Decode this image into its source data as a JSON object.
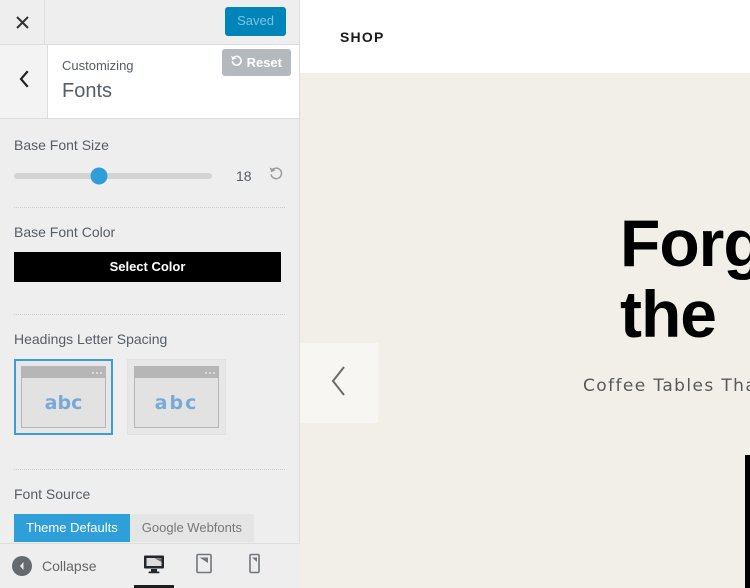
{
  "customizer": {
    "topbar": {
      "close_icon": "close-icon",
      "save_label": "Saved"
    },
    "panel": {
      "back_icon": "chevron-left-icon",
      "subtitle": "Customizing",
      "title": "Fonts",
      "reset_label": "Reset",
      "reset_icon": "rotate-ccw-icon"
    },
    "controls": [
      {
        "name": "base-font-size",
        "label": "Base Font Size",
        "type": "slider",
        "value": "18",
        "slider_percent": 43,
        "info_icon": "info-icon",
        "reset_icon": "rotate-ccw-icon"
      },
      {
        "name": "base-font-color",
        "label": "Base Font Color",
        "type": "color",
        "button_label": "Select Color",
        "color": "#000000"
      },
      {
        "name": "headings-letter-spacing",
        "label": "Headings Letter Spacing",
        "type": "image-radio",
        "options": [
          {
            "name": "letter-spacing-normal",
            "preview_text": "abc",
            "spaced": false,
            "selected": true
          },
          {
            "name": "letter-spacing-wide",
            "preview_text": "abc",
            "spaced": true,
            "selected": false
          }
        ]
      },
      {
        "name": "font-source",
        "label": "Font Source",
        "type": "segmented",
        "options": [
          {
            "name": "theme-defaults",
            "label": "Theme Defaults",
            "active": true
          },
          {
            "name": "google-webfonts",
            "label": "Google Webfonts",
            "active": false
          }
        ]
      }
    ],
    "footer": {
      "collapse_label": "Collapse",
      "collapse_icon": "chevron-left-circle-icon",
      "devices": [
        {
          "name": "desktop",
          "icon": "desktop-icon",
          "active": true
        },
        {
          "name": "tablet",
          "icon": "tablet-icon",
          "active": false
        },
        {
          "name": "mobile",
          "icon": "mobile-icon",
          "active": false
        }
      ]
    }
  },
  "preview": {
    "header": {
      "shop_label": "SHOP"
    },
    "hero": {
      "prev_icon": "chevron-left-icon",
      "title_line1": "Forget",
      "title_line2": "the",
      "subtitle": "Coffee Tables That",
      "cta_color": "#000000",
      "background": "#f2efe9"
    }
  }
}
